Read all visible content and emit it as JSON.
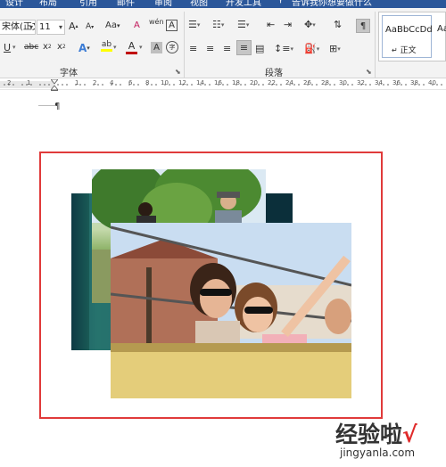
{
  "tabs": [
    "设计",
    "布局",
    "引用",
    "邮件",
    "审阅",
    "视图",
    "开发工具"
  ],
  "tell_me": "告诉我你想要做什么",
  "ribbon": {
    "font_name": "宋体(正文",
    "font_size": "11",
    "font_group_label": "字体",
    "paragraph_group_label": "段落",
    "styles": [
      {
        "sample": "AaBbCcDd",
        "name": "正文"
      },
      {
        "sample": "AaBl",
        "name": ""
      }
    ],
    "buttons": {
      "grow_font": "A",
      "shrink_font": "A",
      "change_case": "Aa",
      "clear_format": "A",
      "phonetic": "wén",
      "char_border": "A",
      "bold": "B",
      "italic": "I",
      "underline": "U",
      "strikethrough": "abc",
      "subscript": "x",
      "superscript": "x",
      "text_effects": "A",
      "highlight": "ab",
      "font_color": "A",
      "char_shading": "A",
      "enclose_char": "字"
    }
  },
  "ruler": {
    "numbers": [
      "2",
      "1",
      "1",
      "2",
      "4",
      "6",
      "8",
      "10",
      "12",
      "14",
      "16",
      "18",
      "20",
      "22",
      "24",
      "26",
      "28",
      "30",
      "32",
      "34",
      "36",
      "38",
      "40"
    ]
  },
  "document": {
    "pilcrow": "¶"
  },
  "watermark": {
    "brand": "经验啦",
    "check": "√",
    "url": "jingyanla.com"
  },
  "colors": {
    "title_bar": "#2b579a",
    "frame_border": "#e03a3a",
    "highlight": "#ffff00",
    "font_color": "#c00000"
  }
}
